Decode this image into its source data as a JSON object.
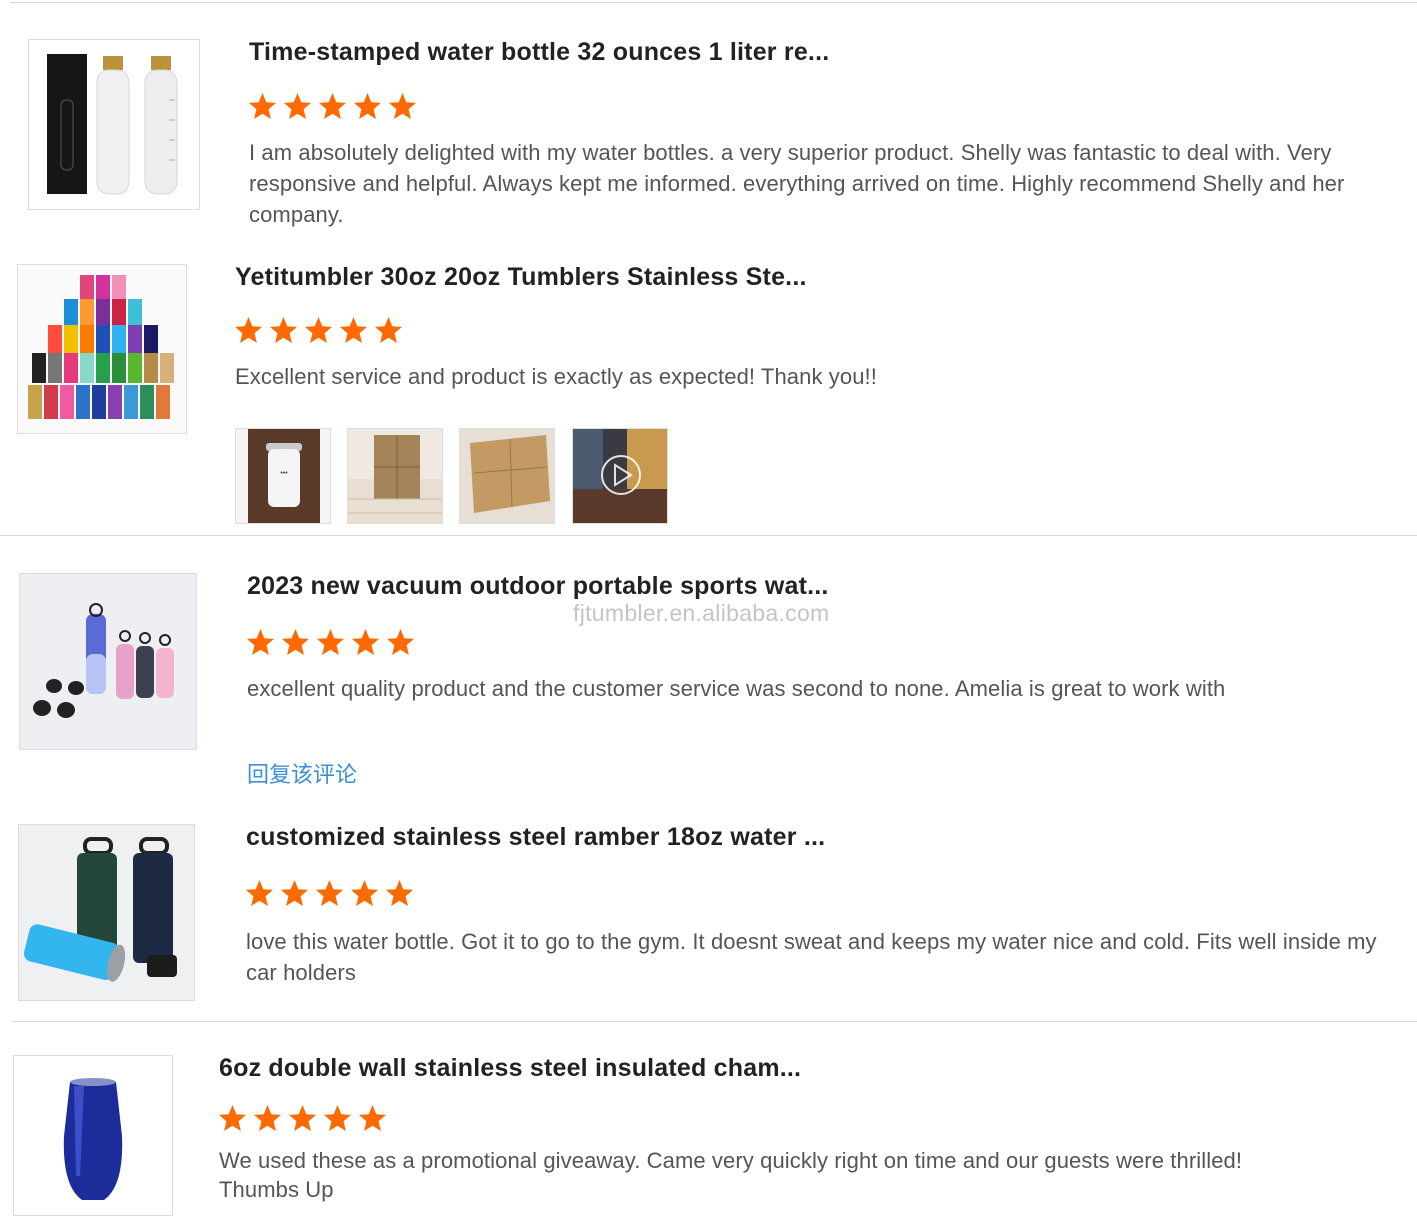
{
  "watermark": "fjtumbler.en.alibaba.com",
  "accent_star_color": "#ff6a00",
  "reply_link_color": "#3a8fd8",
  "reviews": [
    {
      "title": "Time-stamped water bottle 32 ounces 1 liter re...",
      "rating": 5,
      "text": "I am absolutely delighted with my water bottles. a very superior product. Shelly was fantastic to deal with. Very responsive and helpful. Always kept me informed. everything arrived on time. Highly recommend Shelly and her company."
    },
    {
      "title": "Yetitumbler 30oz 20oz Tumblers Stainless Ste...",
      "rating": 5,
      "text": "Excellent service and product is exactly as expected!  Thank you!!",
      "photos": [
        "photo-tumbler",
        "photo-boxes-stacked",
        "photo-box-open",
        "video-thumbnail"
      ]
    },
    {
      "title": "2023 new vacuum outdoor portable sports wat...",
      "rating": 5,
      "text": "excellent quality product and the customer service was second to none. Amelia is great to work with",
      "reply_label": "回复该评论"
    },
    {
      "title": "customized stainless steel ramber 18oz water ...",
      "rating": 5,
      "text": "love this water bottle. Got it to go to the gym. It doesnt sweat and keeps my water nice and cold. Fits well inside my car holders"
    },
    {
      "title": "6oz double wall stainless steel insulated cham...",
      "rating": 5,
      "text": "We used these as a promotional giveaway. Came very quickly right on time and our guests were thrilled! Thumbs Up"
    }
  ]
}
